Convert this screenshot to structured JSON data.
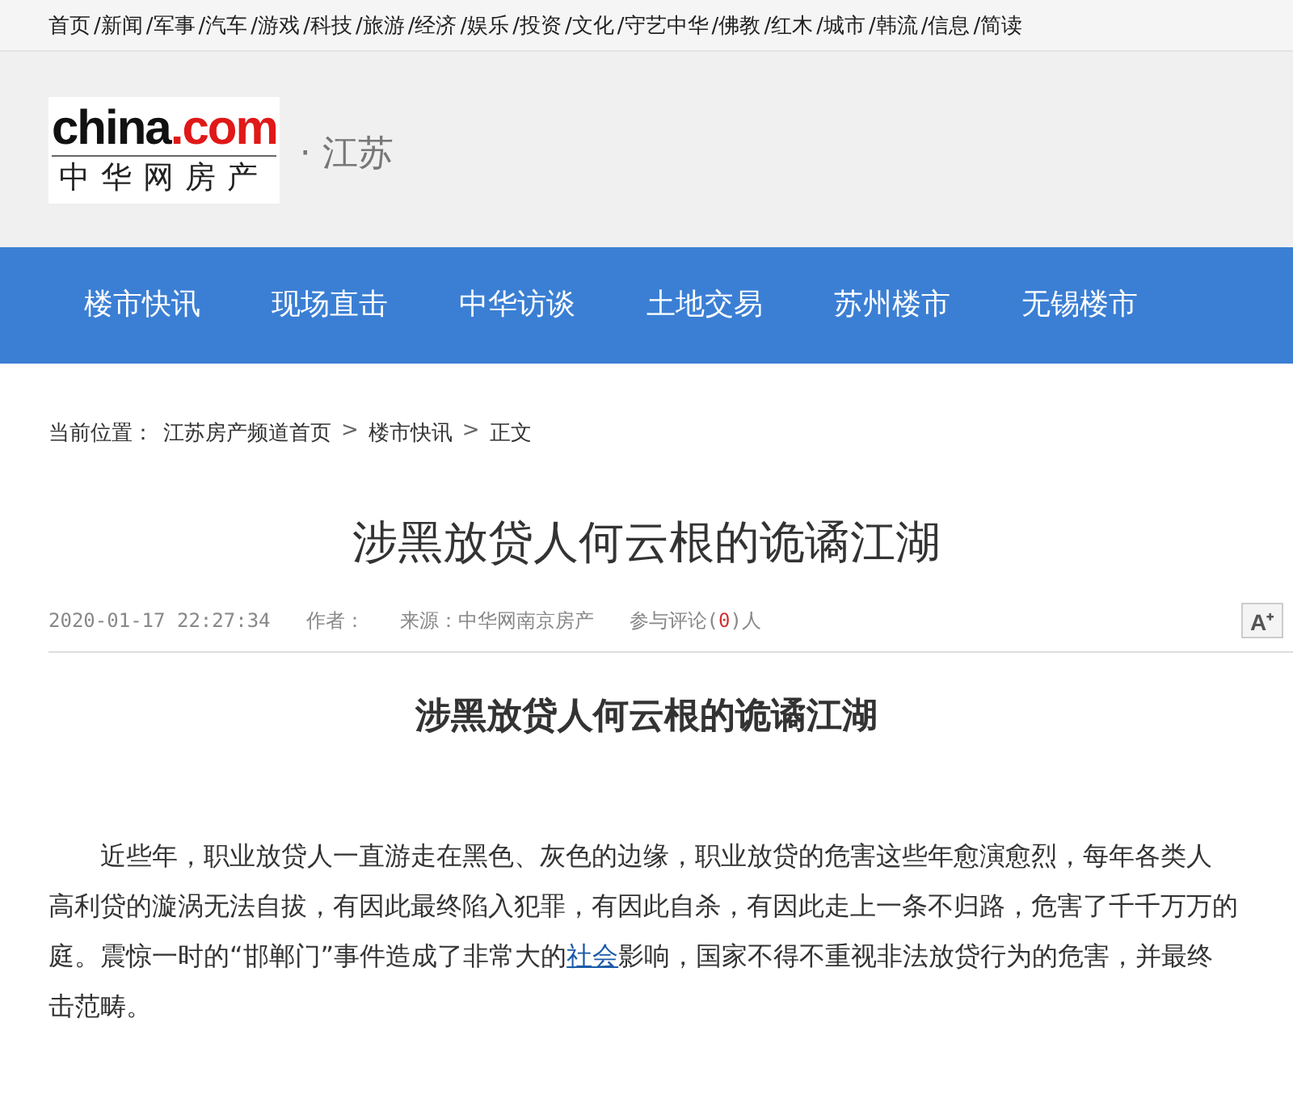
{
  "top_links": [
    "首页",
    "/新闻",
    "/军事",
    "/汽车",
    "/游戏",
    "/科技",
    "/旅游",
    "/经济",
    "/娱乐",
    "/投资",
    "/文化",
    "/守艺中华",
    "/佛教",
    "/红木",
    "/城市",
    "/韩流",
    "/信息",
    "/简读"
  ],
  "logo": {
    "main": "china",
    "accent": ".com",
    "sub": "中华网房产"
  },
  "region": "· 江苏",
  "nav": [
    {
      "label": "楼市快讯",
      "selected": false
    },
    {
      "label": "现场直击",
      "selected": false
    },
    {
      "label": "中华访谈",
      "selected": false
    },
    {
      "label": "土地交易",
      "selected": false
    },
    {
      "label": "苏州楼市",
      "selected": false
    },
    {
      "label": "无锡楼市",
      "selected": false
    }
  ],
  "breadcrumb": {
    "prefix": "当前位置：",
    "items": [
      "江苏房产频道首页",
      "楼市快讯",
      "正文"
    ],
    "separator": ">"
  },
  "title": "涉黑放贷人何云根的诡谲江湖",
  "meta": {
    "date": "2020-01-17 22:27:34",
    "author": "作者：",
    "source": "来源：中华网南京房产",
    "comments_before": "参与评论(",
    "comments_count": "0",
    "comments_after": ")人",
    "font_button": "A⁺"
  },
  "subtitle": "涉黑放贷人何云根的诡谲江湖",
  "paragraph": [
    {
      "text": "近些年，职业放贷人一直游走在黑色、灰色的边缘，职业放贷的危害这些年愈演愈烈，每年各类人"
    },
    {
      "text": "高利贷的漩涡无法自拔，有因此最终陷入犯罪，有因此自杀，有因此走上一条不归路，危害了千千万万的"
    },
    {
      "text": "庭。震惊一时的“邯郸门”事件造成了非常大的",
      "link": "社会",
      "after": "影响，国家不得不重视非法放贷行为的危害，并最终"
    },
    {
      "text": "击范畴。"
    }
  ]
}
